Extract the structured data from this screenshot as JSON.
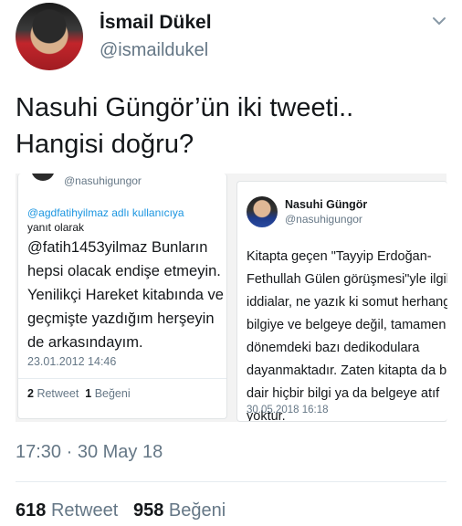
{
  "header": {
    "name": "İsmail Dükel",
    "handle": "@ismaildukel"
  },
  "tweet": {
    "text_line1": "Nasuhi Güngör’ün iki tweeti..",
    "text_line2": "Hangisi doğru?"
  },
  "embed": {
    "left": {
      "top_handle": "@nasuhigungor",
      "reply_to": "@agdfatihyilmaz adlı kullanıcıya",
      "reply_suffix": "yanıt olarak",
      "body_lines": [
        "@fatih1453yilmaz Bunların",
        "hepsi olacak endişe etmeyin.",
        "Yenilikçi Hareket kitabında ve",
        "geçmişte yazdığım herşeyin",
        "de arkasındayım."
      ],
      "date": "23.01.2012 14:46",
      "retweet_count": "2",
      "retweet_label": "Retweet",
      "like_count": "1",
      "like_label": "Beğeni"
    },
    "right": {
      "name": "Nasuhi Güngör",
      "handle": "@nasuhigungor",
      "body_lines": [
        "Kitapta geçen \"Tayyip Erdoğan-",
        "Fethullah Gülen görüşmesi\"yle ilgili",
        "iddialar, ne yazık ki somut herhangi bir",
        "bilgiye ve belgeye değil, tamamen o",
        "dönemdeki bazı dedikodulara",
        "dayanmaktadır. Zaten kitapta da bunu",
        "dair hiçbir bilgi ya da belgeye atıf",
        "yoktur."
      ],
      "date": "30.05.2018 16:18"
    }
  },
  "footer": {
    "timestamp": "17:30 · 30 May 18",
    "retweet_count": "618",
    "retweet_label": "Retweet",
    "like_count": "958",
    "like_label": "Beğeni"
  },
  "icons": {
    "avatar": "avatar-photo",
    "menu": "chevron-down-icon"
  }
}
